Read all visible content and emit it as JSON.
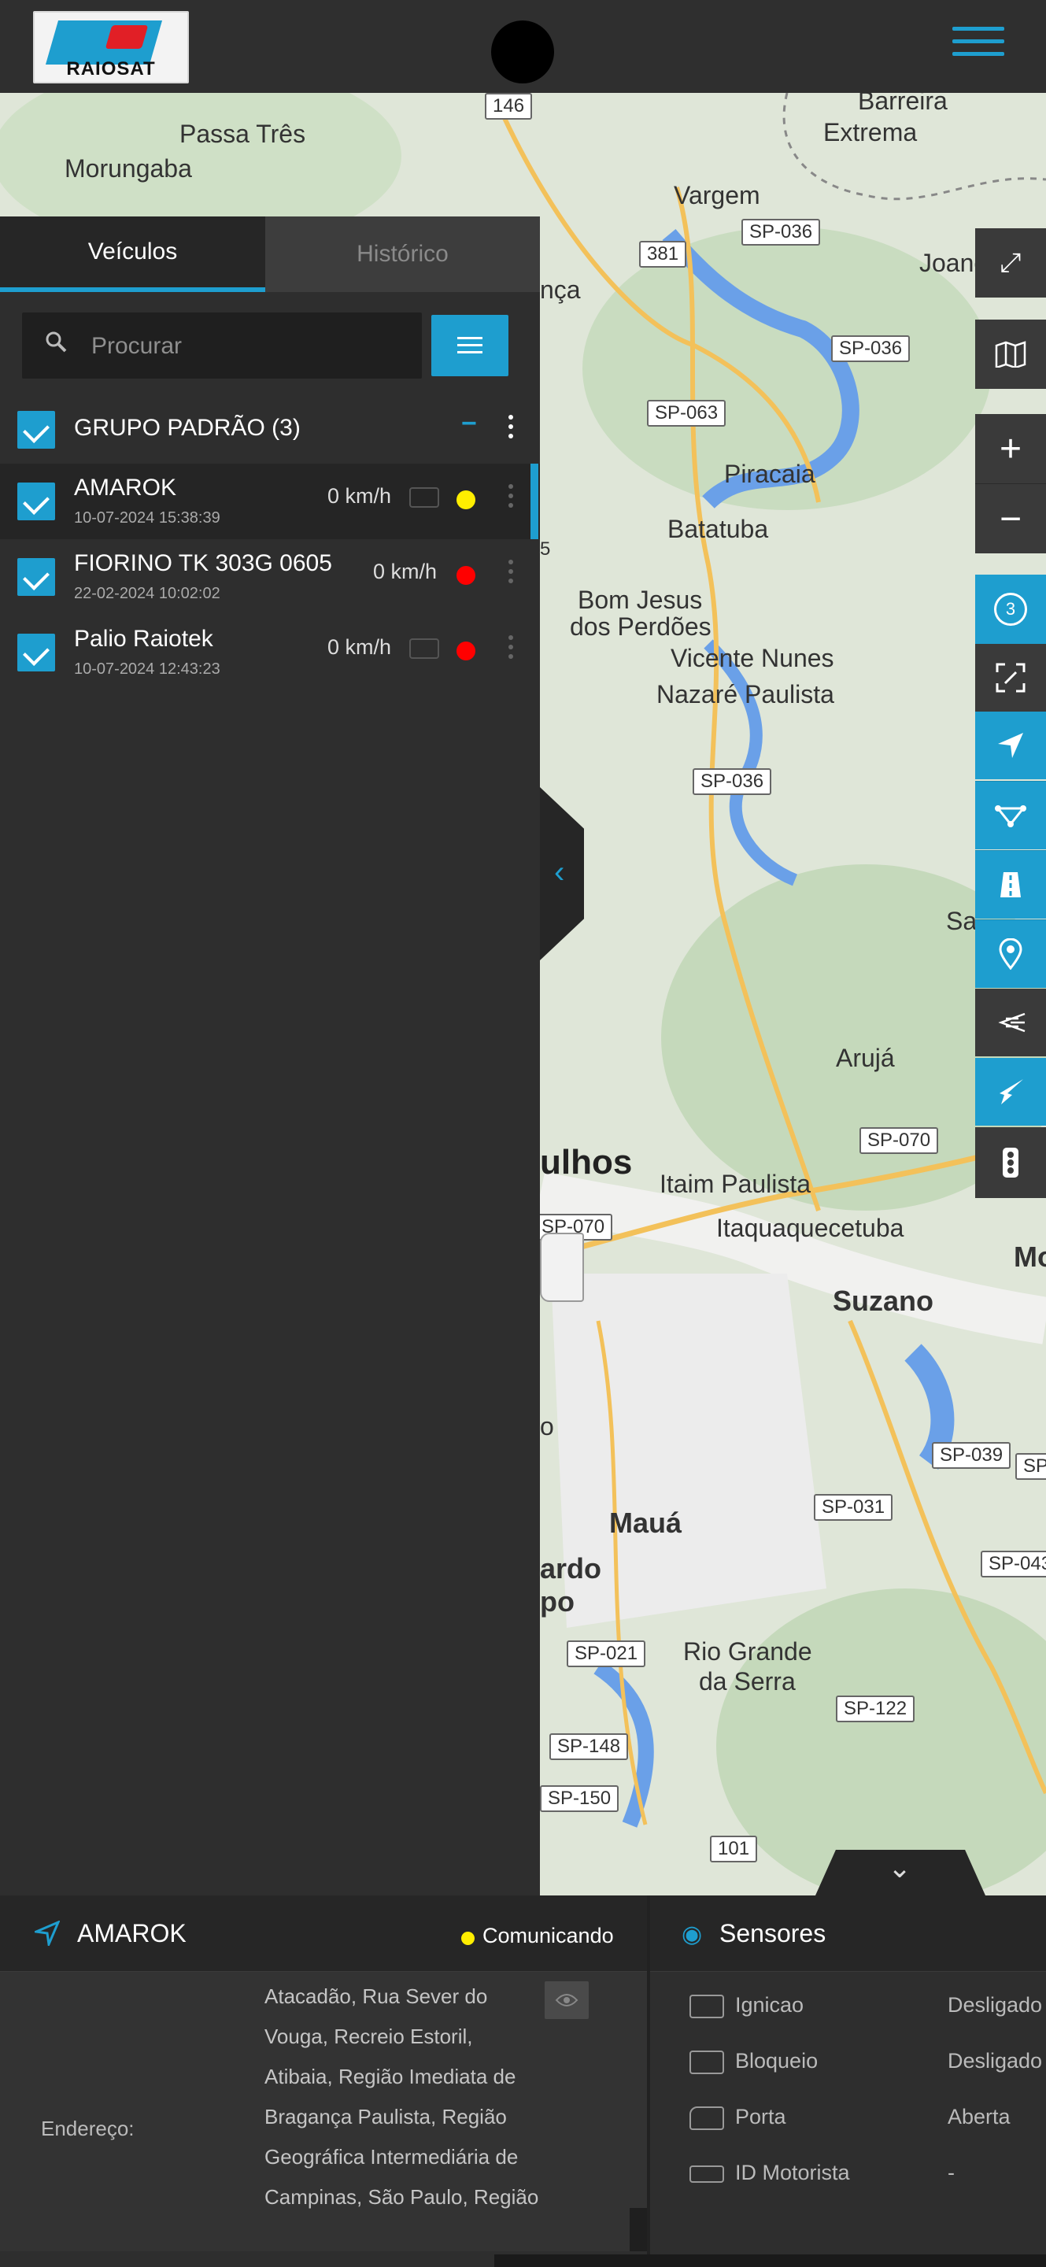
{
  "header": {
    "logo_text": "RAIOSAT",
    "menu_icon": "hamburger-icon"
  },
  "map": {
    "places": [
      "Passa Três",
      "Morungaba",
      "Barreira",
      "Extrema",
      "Vargem",
      "Joanópo",
      "Piracaia",
      "Batatuba",
      "Bom Jesus",
      "dos Perdões",
      "Vicente Nunes",
      "Nazaré Paulista",
      "Sa",
      "Arujá",
      "ulhos",
      "Itaim Paulista",
      "Itaquaquecetuba",
      "Suzano",
      "Mo",
      "Mauá",
      "ardo",
      "po",
      "Rio Grande",
      "da Serra",
      "nça",
      "o",
      "5"
    ],
    "shields": [
      "146",
      "SP-036",
      "381",
      "SP-036",
      "SP-063",
      "SP-036",
      "SP-070",
      "SP-070",
      "SP-039",
      "SP",
      "SP-031",
      "SP-043",
      "SP-021",
      "SP-122",
      "SP-148",
      "SP-150",
      "101"
    ]
  },
  "map_controls": {
    "fullscreen_icon": "fullscreen-icon",
    "layers_icon": "map-layers-icon",
    "zoom_in": "+",
    "zoom_out": "−",
    "cluster_count": "3"
  },
  "sidebar": {
    "tabs": [
      "Veículos",
      "Histórico"
    ],
    "search_placeholder": "Procurar",
    "group": {
      "label": "GRUPO PADRÃO (3)",
      "collapse": "−"
    },
    "vehicles": [
      {
        "name": "AMAROK",
        "date": "10-07-2024 15:38:39",
        "speed": "0 km/h",
        "status_color": "#ffee00"
      },
      {
        "name": "FIORINO TK 303G 0605",
        "date": "22-02-2024 10:02:02",
        "speed": "0 km/h",
        "status_color": "#ff0000"
      },
      {
        "name": "Palio Raiotek",
        "date": "10-07-2024 12:43:23",
        "speed": "0 km/h",
        "status_color": "#ff0000"
      }
    ]
  },
  "info_panel": {
    "vehicle": "AMAROK",
    "status": "Comunicando",
    "status_color": "#ffee00",
    "address_label": "Endereço:",
    "address_lines": [
      "Atacadão, Rua Sever do",
      "Vouga, Recreio Estoril,",
      "Atibaia, Região Imediata de",
      "Bragança Paulista, Região",
      "Geográfica Intermediária de",
      "Campinas, São Paulo, Região"
    ]
  },
  "sensors": {
    "title": "Sensores",
    "items": [
      {
        "label": "Ignicao",
        "value": "Desligado"
      },
      {
        "label": "Bloqueio",
        "value": "Desligado"
      },
      {
        "label": "Porta",
        "value": "Aberta"
      },
      {
        "label": "ID Motorista",
        "value": "-"
      }
    ]
  },
  "colors": {
    "accent": "#1e9ecf",
    "panel": "#2e2e2e"
  }
}
